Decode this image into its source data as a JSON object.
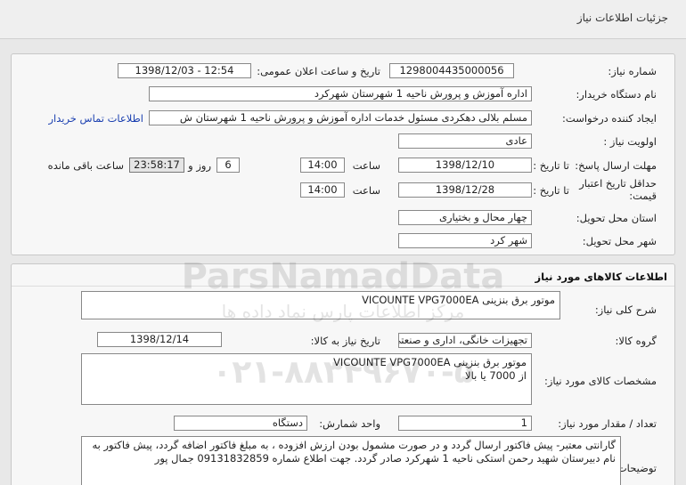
{
  "header": {
    "title": "جزئیات اطلاعات نیاز"
  },
  "info": {
    "need_number_label": "شماره نیاز:",
    "need_number": "1298004435000056",
    "announce_label": "تاریخ و ساعت اعلان عمومی:",
    "announce_value": "1398/12/03 - 12:54",
    "buyer_org_label": "نام دستگاه خریدار:",
    "buyer_org": "اداره آموزش و پرورش ناحیه 1 شهرستان شهرکرد",
    "requester_label": "ایجاد کننده درخواست:",
    "requester": "مسلم بلالی دهکردی مسئول خدمات اداره آموزش و پرورش ناحیه 1 شهرستان ش",
    "contact_link": "اطلاعات تماس خریدار",
    "priority_label": "اولویت نیاز :",
    "priority": "عادی",
    "deadline_label": "مهلت ارسال پاسخ:",
    "to_date_label": "تا تاریخ :",
    "deadline_date": "1398/12/10",
    "time_label": "ساعت",
    "deadline_time": "14:00",
    "days_value": "6",
    "days_label": "روز و",
    "remaining_time": "23:58:17",
    "remaining_label": "ساعت باقی مانده",
    "validity_label_1": "حداقل تاریخ اعتبار",
    "validity_label_2": "قیمت:",
    "validity_to_label": "تا تاریخ :",
    "validity_date": "1398/12/28",
    "validity_time_label": "ساعت",
    "validity_time": "14:00",
    "province_label": "استان محل تحویل:",
    "province": "چهار محال و بختیاری",
    "city_label": "شهر محل تحویل:",
    "city": "شهر کرد"
  },
  "goods": {
    "section_title": "اطلاعات کالاهای مورد نیاز",
    "summary_label": "شرح کلی نیاز:",
    "summary": "موتور برق بنزینی VICOUNTE VPG7000EA",
    "group_label": "گروه کالا:",
    "group": "تجهیزات خانگی، اداری و صنعتی",
    "need_date_label": "تاریخ نیاز به کالا:",
    "need_date": "1398/12/14",
    "specs_label": "مشخصات کالای مورد نیاز:",
    "specs_line1": "موتور برق بنزینی VICOUNTE VPG7000EA",
    "specs_line2": "از 7000 یا بالا",
    "qty_label": "تعداد / مقدار مورد نیاز:",
    "qty": "1",
    "unit_label": "واحد شمارش:",
    "unit": "دستگاه",
    "notes_label": "توضیحات خریدار:",
    "notes": "گارانتی معتبر- پیش فاکتور  ارسال گردد و در صورت  مشمول بودن ارزش افزوده ، به مبلغ فاکتور اضافه گردد، پیش فاکتور به نام دبیرستان شهید رحمن استکی ناحیه 1 شهرکرد صادر گردد. جهت اطلاع شماره 09131832859 جمال پور"
  },
  "watermark": {
    "line1": "ParsNamadData",
    "line2": "مرکز اطلاعات پارس نماد داده ها",
    "line3": "۰۲۱-۸۸۳۴۹۶۷۰-۵"
  }
}
